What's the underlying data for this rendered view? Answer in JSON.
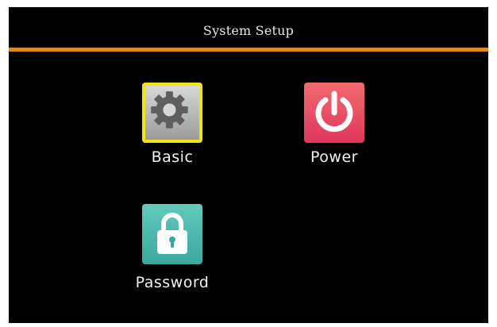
{
  "header": {
    "title": "System Setup",
    "accent_color": "#e08a1e"
  },
  "menu": {
    "items": [
      {
        "label": "Basic",
        "icon": "gear-icon",
        "selected": true
      },
      {
        "label": "Power",
        "icon": "power-icon",
        "selected": false
      },
      {
        "label": "Password",
        "icon": "lock-icon",
        "selected": false
      }
    ],
    "selection_color": "#f2e21a"
  }
}
